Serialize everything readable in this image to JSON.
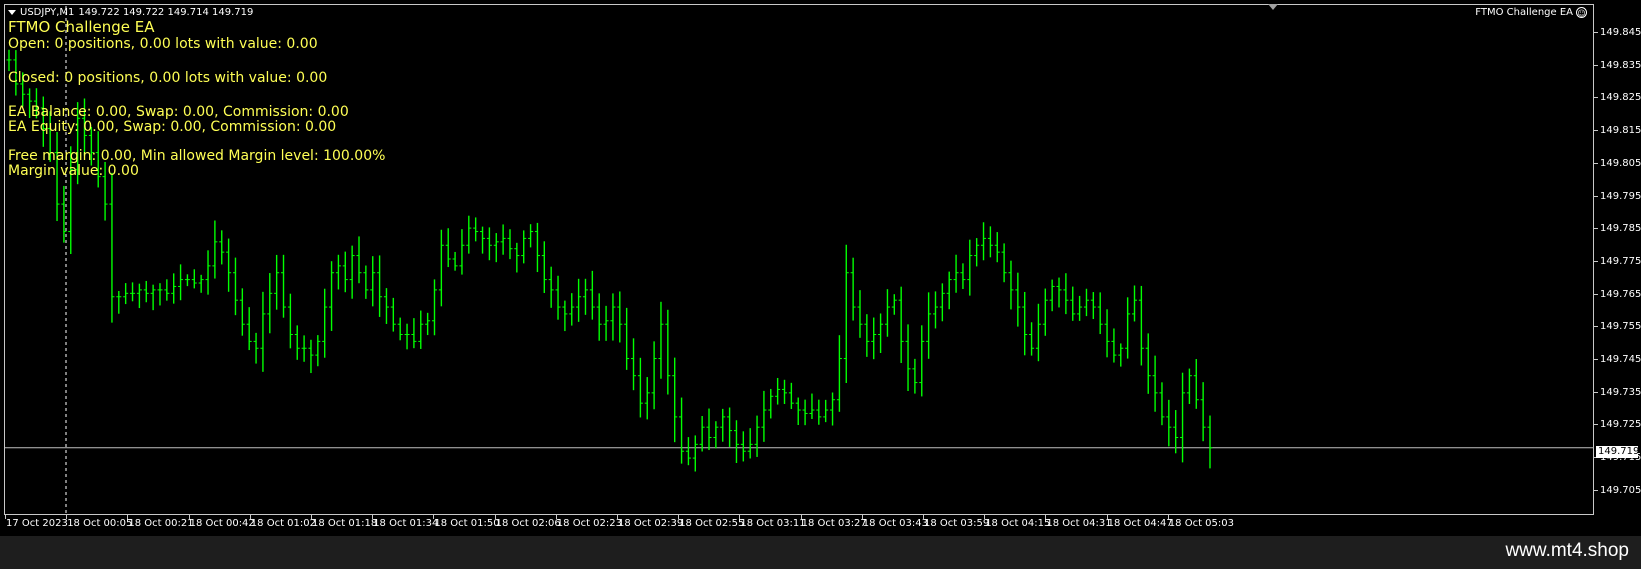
{
  "header": {
    "symbol": "USDJPY,M1",
    "ohlc": "149.722 149.722 149.714 149.719",
    "ea_name": "FTMO Challenge EA"
  },
  "ea_panel": {
    "title": "FTMO Challenge EA",
    "open_line": "Open: 0 positions, 0.00 lots with value: 0.00",
    "closed_line": "Closed: 0 positions, 0.00 lots with value: 0.00",
    "balance_line": "EA Balance: 0.00, Swap: 0.00, Commission: 0.00",
    "equity_line": "EA Equity: 0.00, Swap: 0.00, Commission: 0.00",
    "free_margin_line": "Free margin: 0.00, Min allowed Margin level: 100.00%",
    "margin_value_line": "Margin value: 0.00"
  },
  "price_axis": {
    "labels": [
      "149.845",
      "149.835",
      "149.825",
      "149.815",
      "149.805",
      "149.795",
      "149.785",
      "149.775",
      "149.765",
      "149.755",
      "149.745",
      "149.735",
      "149.725",
      "149.715",
      "149.705"
    ],
    "bid": "149.719"
  },
  "time_axis": {
    "labels": [
      "17 Oct 2023",
      "18 Oct 00:05",
      "18 Oct 00:21",
      "18 Oct 00:42",
      "18 Oct 01:02",
      "18 Oct 01:18",
      "18 Oct 01:34",
      "18 Oct 01:50",
      "18 Oct 02:06",
      "18 Oct 02:23",
      "18 Oct 02:39",
      "18 Oct 02:55",
      "18 Oct 03:11",
      "18 Oct 03:27",
      "18 Oct 03:43",
      "18 Oct 03:59",
      "18 Oct 04:15",
      "18 Oct 04:31",
      "18 Oct 04:47",
      "18 Oct 05:03"
    ]
  },
  "chart_data": {
    "type": "bar",
    "symbol": "USDJPY",
    "timeframe": "M1",
    "ylim": [
      149.7,
      149.848
    ],
    "bid_price": 149.719,
    "series": [
      {
        "values": [
          149.832,
          149.825,
          149.822,
          149.82,
          149.818,
          149.812,
          149.805,
          149.79,
          149.782,
          149.8,
          149.815,
          149.81,
          149.805,
          149.798,
          149.79,
          149.763,
          149.763,
          149.764,
          149.764,
          149.765,
          149.764,
          149.765,
          149.765,
          149.764,
          149.766,
          149.768,
          149.768,
          149.767,
          149.768,
          149.772,
          149.779,
          149.776,
          149.77,
          149.762,
          149.755,
          149.75,
          149.748,
          149.758,
          149.764,
          149.77,
          149.76,
          149.752,
          149.748,
          149.748,
          149.746,
          149.75,
          149.76,
          149.77,
          149.772,
          149.768,
          149.775,
          149.77,
          149.765,
          149.77,
          149.763,
          149.76,
          149.755,
          149.752,
          149.752,
          149.75,
          149.755,
          149.756,
          149.765,
          149.778,
          149.774,
          149.772,
          149.778,
          149.783,
          149.782,
          149.78,
          149.778,
          149.779,
          149.78,
          149.777,
          149.775,
          149.78,
          149.782,
          149.775,
          149.768,
          149.765,
          149.76,
          149.758,
          149.76,
          149.763,
          149.765,
          149.76,
          149.755,
          149.756,
          149.76,
          149.755,
          149.745,
          149.74,
          149.732,
          149.735,
          149.745,
          149.755,
          149.74,
          149.728,
          149.718,
          149.716,
          149.72,
          149.725,
          149.722,
          149.725,
          149.728,
          149.724,
          149.72,
          149.718,
          149.72,
          149.725,
          149.73,
          149.734,
          149.736,
          149.735,
          149.732,
          149.73,
          149.729,
          149.73,
          149.728,
          149.73,
          149.733,
          149.745,
          149.77,
          149.76,
          149.755,
          149.75,
          149.752,
          149.755,
          149.76,
          149.762,
          149.75,
          149.742,
          149.738,
          149.75,
          149.758,
          149.76,
          149.764,
          149.768,
          149.77,
          149.768,
          149.775,
          149.778,
          149.78,
          149.778,
          149.776,
          149.77,
          149.765,
          149.76,
          149.752,
          149.748,
          149.755,
          149.762,
          149.766,
          149.765,
          149.762,
          149.758,
          149.76,
          149.762,
          149.76,
          149.755,
          149.75,
          149.746,
          149.748,
          149.758,
          149.762,
          149.748,
          149.74,
          149.735,
          149.728,
          149.725,
          149.722,
          149.735,
          149.74,
          149.733,
          149.725,
          149.719
        ]
      }
    ]
  }
}
